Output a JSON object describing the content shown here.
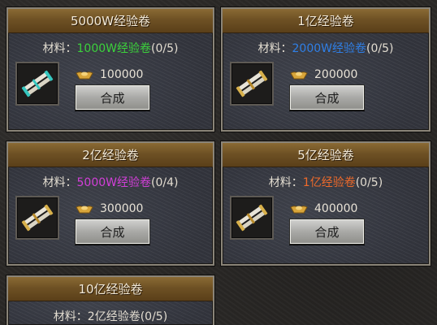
{
  "material_prefix": "材料：",
  "cards": [
    {
      "title": "5000W经验卷",
      "material_name": "1000W经验卷",
      "material_color": "#3bd23b",
      "material_count": "(0/5)",
      "cost": "100000",
      "button_label": "合成",
      "scroll_accent": "#35c7c0"
    },
    {
      "title": "1亿经验卷",
      "material_name": "2000W经验卷",
      "material_color": "#2f7fe6",
      "material_count": "(0/5)",
      "cost": "200000",
      "button_label": "合成",
      "scroll_accent": "#d8b04a"
    },
    {
      "title": "2亿经验卷",
      "material_name": "5000W经验卷",
      "material_color": "#d23fd8",
      "material_count": "(0/4)",
      "cost": "300000",
      "button_label": "合成",
      "scroll_accent": "#d8b04a"
    },
    {
      "title": "5亿经验卷",
      "material_name": "1亿经验卷",
      "material_color": "#ef6a2a",
      "material_count": "(0/5)",
      "cost": "400000",
      "button_label": "合成",
      "scroll_accent": "#d8b04a"
    },
    {
      "title": "10亿经验卷",
      "material_name": "2亿经验卷",
      "material_color": "#e2dcd0",
      "material_count": "(0/5)",
      "cost": "",
      "button_label": "",
      "scroll_accent": "#d8b04a"
    }
  ]
}
